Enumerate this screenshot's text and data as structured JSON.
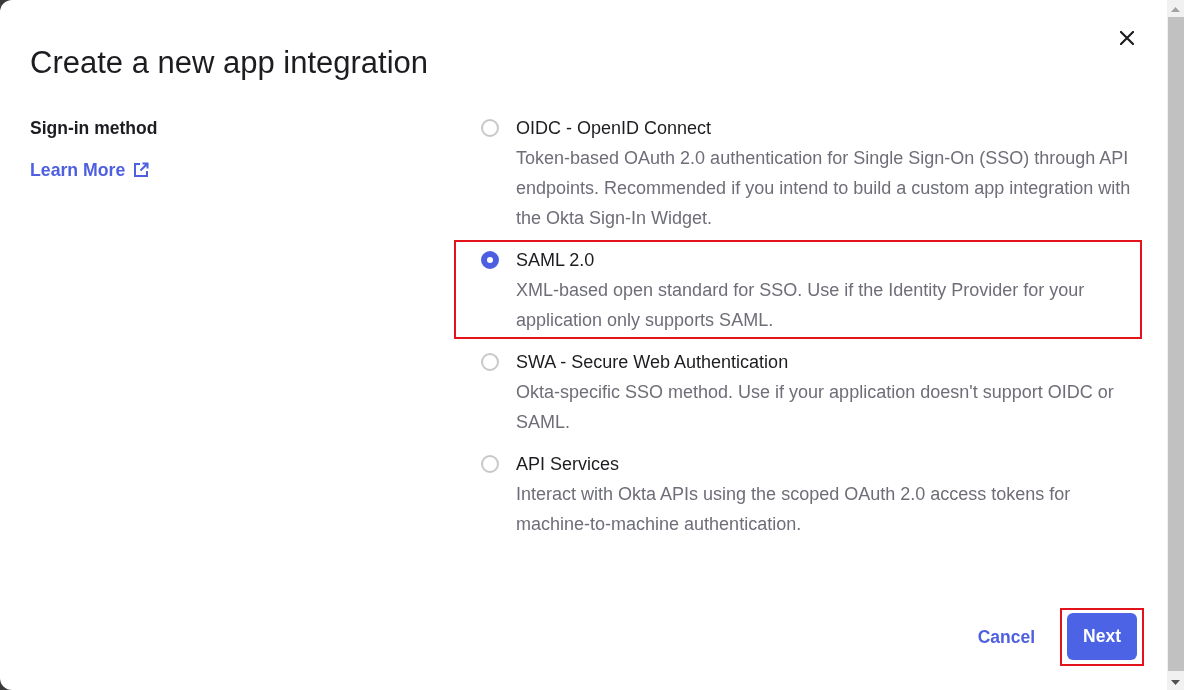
{
  "dialog": {
    "title": "Create a new app integration"
  },
  "section": {
    "label": "Sign-in method",
    "link": "Learn More"
  },
  "options": [
    {
      "label": "OIDC - OpenID Connect",
      "description": "Token-based OAuth 2.0 authentication for Single Sign-On (SSO) through API endpoints. Recommended if you intend to build a custom app integration with the Okta Sign-In Widget.",
      "selected": false,
      "highlighted": false
    },
    {
      "label": "SAML 2.0",
      "description": "XML-based open standard for SSO. Use if the Identity Provider for your application only supports SAML.",
      "selected": true,
      "highlighted": true
    },
    {
      "label": "SWA - Secure Web Authentication",
      "description": "Okta-specific SSO method. Use if your application doesn't support OIDC or SAML.",
      "selected": false,
      "highlighted": false
    },
    {
      "label": "API Services",
      "description": "Interact with Okta APIs using the scoped OAuth 2.0 access tokens for machine-to-machine authentication.",
      "selected": false,
      "highlighted": false
    }
  ],
  "footer": {
    "buttons": [
      {
        "label": "Cancel",
        "kind": "link",
        "highlighted": false
      },
      {
        "label": "Next",
        "kind": "primary",
        "highlighted": true
      }
    ]
  }
}
